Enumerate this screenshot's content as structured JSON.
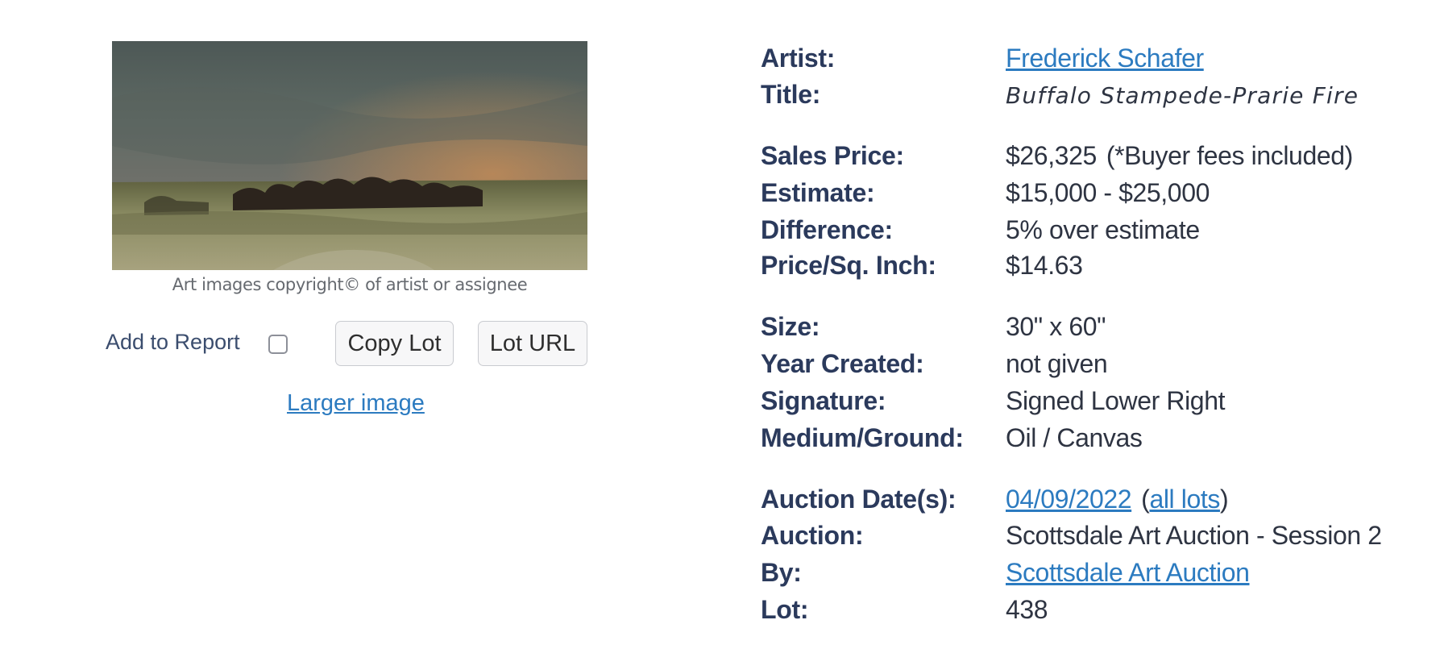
{
  "artwork": {
    "copyright": "Art images copyright© of artist or assignee",
    "add_to_report_label": "Add to Report",
    "add_to_report_checked": false,
    "copy_lot_label": "Copy Lot",
    "lot_url_label": "Lot URL",
    "larger_image_label": "Larger image"
  },
  "details": {
    "artist_label": "Artist:",
    "artist": "Frederick Schafer",
    "title_label": "Title:",
    "title": "Buffalo Stampede-Prarie Fire",
    "sales_price_label": "Sales Price:",
    "sales_price": "$26,325",
    "buyer_fees_note": "(*Buyer fees included)",
    "estimate_label": "Estimate:",
    "estimate": "$15,000 - $25,000",
    "difference_label": "Difference:",
    "difference": "5% over estimate",
    "price_sq_inch_label": "Price/Sq. Inch:",
    "price_sq_inch": "$14.63",
    "size_label": "Size:",
    "size": "30\" x 60\"",
    "year_created_label": "Year Created:",
    "year_created": "not given",
    "signature_label": "Signature:",
    "signature": "Signed Lower Right",
    "medium_label": "Medium/Ground:",
    "medium": "Oil / Canvas",
    "auction_date_label": "Auction Date(s):",
    "auction_date": "04/09/2022",
    "all_lots_label": "all lots",
    "auction_label": "Auction:",
    "auction": "Scottsdale Art Auction - Session 2",
    "by_label": "By:",
    "by": "Scottsdale Art Auction",
    "lot_label": "Lot:",
    "lot": "438"
  },
  "colors": {
    "link": "#2c7bc0",
    "label": "#2b3a5c",
    "value": "#2e3442",
    "sky_dark": "#4b5552",
    "sunset_orange": "#e0782e",
    "grass": "#8a8b64"
  }
}
